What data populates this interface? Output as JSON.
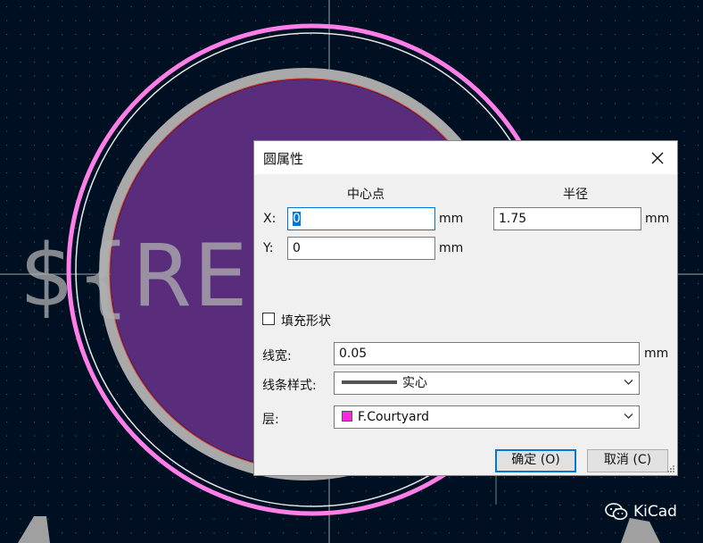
{
  "canvas": {
    "ref_text": "${REF",
    "background_color": "#001023",
    "courtyard_color": "#ff26e2",
    "fill_color": "#5a2d7c"
  },
  "dialog": {
    "title": "圆属性",
    "close_icon": "close-icon",
    "center": {
      "label": "中心点",
      "x_label": "X:",
      "x_value": "0",
      "y_label": "Y:",
      "y_value": "0",
      "unit": "mm"
    },
    "radius": {
      "label": "半径",
      "value": "1.75",
      "unit": "mm"
    },
    "fill_shape_label": "填充形状",
    "line_width": {
      "label": "线宽:",
      "value": "0.05",
      "unit": "mm"
    },
    "line_style": {
      "label": "线条样式:",
      "value": "实心"
    },
    "layer": {
      "label": "层:",
      "value": "F.Courtyard",
      "color": "#ff26e2"
    },
    "ok_label": "确定 (O)",
    "cancel_label": "取消 (C)"
  },
  "watermark": {
    "icon": "wechat-icon",
    "text": "KiCad"
  }
}
